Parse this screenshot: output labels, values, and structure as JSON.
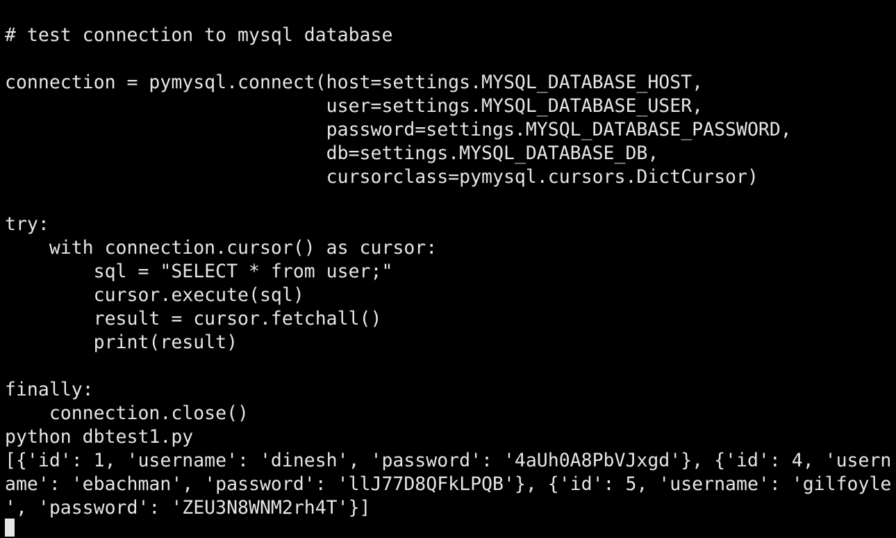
{
  "terminal": {
    "lines": [
      "",
      "# test connection to mysql database",
      "",
      "connection = pymysql.connect(host=settings.MYSQL_DATABASE_HOST,",
      "                             user=settings.MYSQL_DATABASE_USER,",
      "                             password=settings.MYSQL_DATABASE_PASSWORD,",
      "                             db=settings.MYSQL_DATABASE_DB,",
      "                             cursorclass=pymysql.cursors.DictCursor)",
      "",
      "try:",
      "    with connection.cursor() as cursor:",
      "        sql = \"SELECT * from user;\"",
      "        cursor.execute(sql)",
      "        result = cursor.fetchall()",
      "        print(result)",
      "",
      "finally:",
      "    connection.close()",
      "python dbtest1.py",
      "[{'id': 1, 'username': 'dinesh', 'password': '4aUh0A8PbVJxgd'}, {'id': 4, 'usern",
      "ame': 'ebachman', 'password': 'llJ77D8QFkLPQB'}, {'id': 5, 'username': 'gilfoyle",
      "', 'password': 'ZEU3N8WNM2rh4T'}]"
    ],
    "colors": {
      "background": "#000000",
      "foreground": "#e6e6e6",
      "cursor": "#e6e6e6"
    }
  }
}
